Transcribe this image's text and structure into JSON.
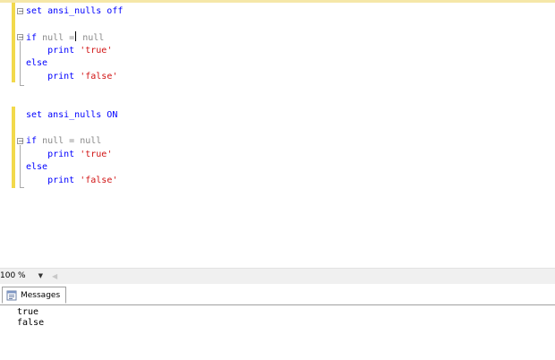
{
  "editor": {
    "lines": [
      {
        "parts": [
          {
            "t": "set ansi_nulls off",
            "c": "kw"
          }
        ]
      },
      {
        "parts": []
      },
      {
        "parts": [
          {
            "t": "if",
            "c": "kw"
          },
          {
            "t": " null ",
            "c": "gr"
          },
          {
            "t": "=",
            "c": "gr"
          },
          {
            "t": "caret",
            "c": "caret"
          },
          {
            "t": " null",
            "c": "gr"
          }
        ]
      },
      {
        "parts": [
          {
            "t": "    print ",
            "c": "kw"
          },
          {
            "t": "'true'",
            "c": "str"
          }
        ]
      },
      {
        "parts": [
          {
            "t": "else",
            "c": "kw"
          }
        ]
      },
      {
        "parts": [
          {
            "t": "    print ",
            "c": "kw"
          },
          {
            "t": "'false'",
            "c": "str"
          }
        ]
      },
      {
        "parts": []
      },
      {
        "parts": []
      },
      {
        "parts": [
          {
            "t": "set ansi_nulls ON",
            "c": "kw"
          }
        ]
      },
      {
        "parts": []
      },
      {
        "parts": [
          {
            "t": "if",
            "c": "kw"
          },
          {
            "t": " null = null",
            "c": "gr"
          }
        ]
      },
      {
        "parts": [
          {
            "t": "    print ",
            "c": "kw"
          },
          {
            "t": "'true'",
            "c": "str"
          }
        ]
      },
      {
        "parts": [
          {
            "t": "else",
            "c": "kw"
          }
        ]
      },
      {
        "parts": [
          {
            "t": "    print ",
            "c": "kw"
          },
          {
            "t": "'false'",
            "c": "str"
          }
        ]
      }
    ]
  },
  "statusbar": {
    "zoom": "100 %"
  },
  "results": {
    "tab_label": "Messages",
    "messages": [
      "true",
      "false"
    ]
  },
  "colors": {
    "keyword": "#0000ff",
    "operator": "#8a8a8a",
    "string": "#d11414",
    "change_bar": "#f2d94b"
  }
}
